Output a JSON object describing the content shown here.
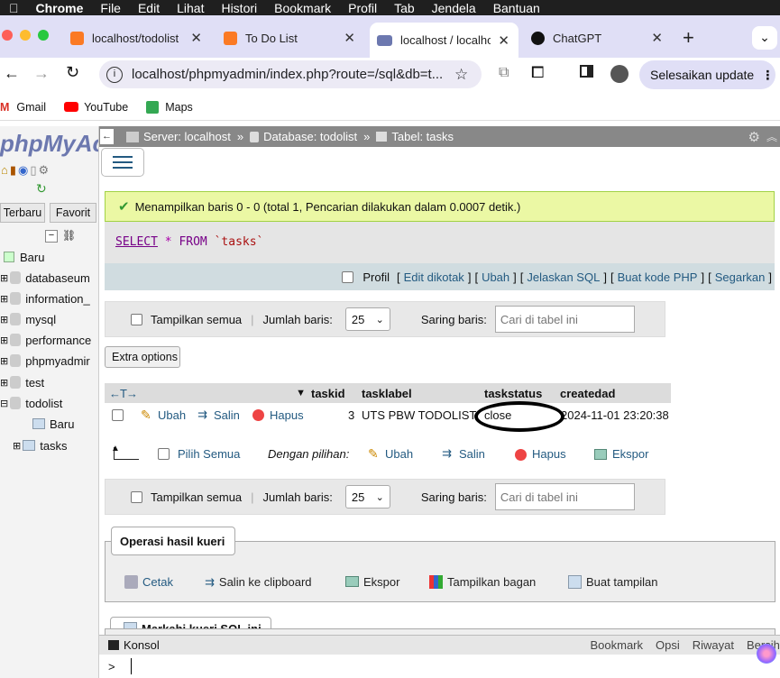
{
  "menubar": {
    "items": [
      "Chrome",
      "File",
      "Edit",
      "Lihat",
      "Histori",
      "Bookmark",
      "Profil",
      "Tab",
      "Jendela",
      "Bantuan"
    ]
  },
  "tabs": [
    {
      "label": "localhost/todolist"
    },
    {
      "label": "To Do List"
    },
    {
      "label": "localhost / localho"
    },
    {
      "label": "ChatGPT"
    }
  ],
  "address": {
    "url": "localhost/phpmyadmin/index.php?route=/sql&db=t..."
  },
  "update_button": "Selesaikan update",
  "bookmarks": [
    "Gmail",
    "YouTube",
    "Maps"
  ],
  "pma": {
    "logo": "phpMyAc",
    "left_tabs": [
      "Terbaru",
      "Favorit"
    ],
    "tree": [
      "Baru",
      "databaseum",
      "information_",
      "mysql",
      "performance",
      "phpmyadmir",
      "test",
      "todolist",
      "Baru",
      "tasks"
    ],
    "breadcrumb": {
      "server": "Server: localhost",
      "db": "Database: todolist",
      "table": "Tabel: tasks",
      "sep": "»"
    },
    "success": "Menampilkan baris 0 - 0 (total 1, Pencarian dilakukan dalam 0.0007 detik.)",
    "sql": {
      "kw1": "SELECT",
      "star": "*",
      "kw2": "FROM",
      "table": "`tasks`"
    },
    "sql_options": {
      "profil": "Profil",
      "edit": "Edit dikotak",
      "ubah": "Ubah",
      "jelaskan": "Jelaskan SQL",
      "kode": "Buat kode PHP",
      "segarkan": "Segarkan"
    },
    "nav": {
      "show_all": "Tampilkan semua",
      "rows_label": "Jumlah baris:",
      "rows_value": "25",
      "filter_label": "Saring baris:",
      "filter_placeholder": "Cari di tabel ini"
    },
    "extra_options": "Extra options",
    "columns": [
      "taskid",
      "tasklabel",
      "taskstatus",
      "createdad"
    ],
    "row": {
      "ubah": "Ubah",
      "salin": "Salin",
      "hapus": "Hapus",
      "taskid": "3",
      "tasklabel": "UTS PBW TODOLIST",
      "taskstatus": "close",
      "createdad": "2024-11-01 23:20:38"
    },
    "bulk": {
      "select_all": "Pilih Semua",
      "with_selected": "Dengan pilihan:",
      "ubah": "Ubah",
      "salin": "Salin",
      "hapus": "Hapus",
      "ekspor": "Ekspor"
    },
    "ops_title": "Operasi hasil kueri",
    "ops": [
      "Cetak",
      "Salin ke clipboard",
      "Ekspor",
      "Tampilkan bagan",
      "Buat tampilan"
    ],
    "bookmark_title": "Markahi kueri SQL ini",
    "console": {
      "label": "Konsol",
      "links": [
        "Bookmark",
        "Opsi",
        "Riwayat",
        "Bersih"
      ],
      "prompt": ">"
    }
  },
  "colors": {
    "accent": "#235a81",
    "success_bg": "#ebf8a4",
    "tab_bar": "#e0dff6"
  }
}
